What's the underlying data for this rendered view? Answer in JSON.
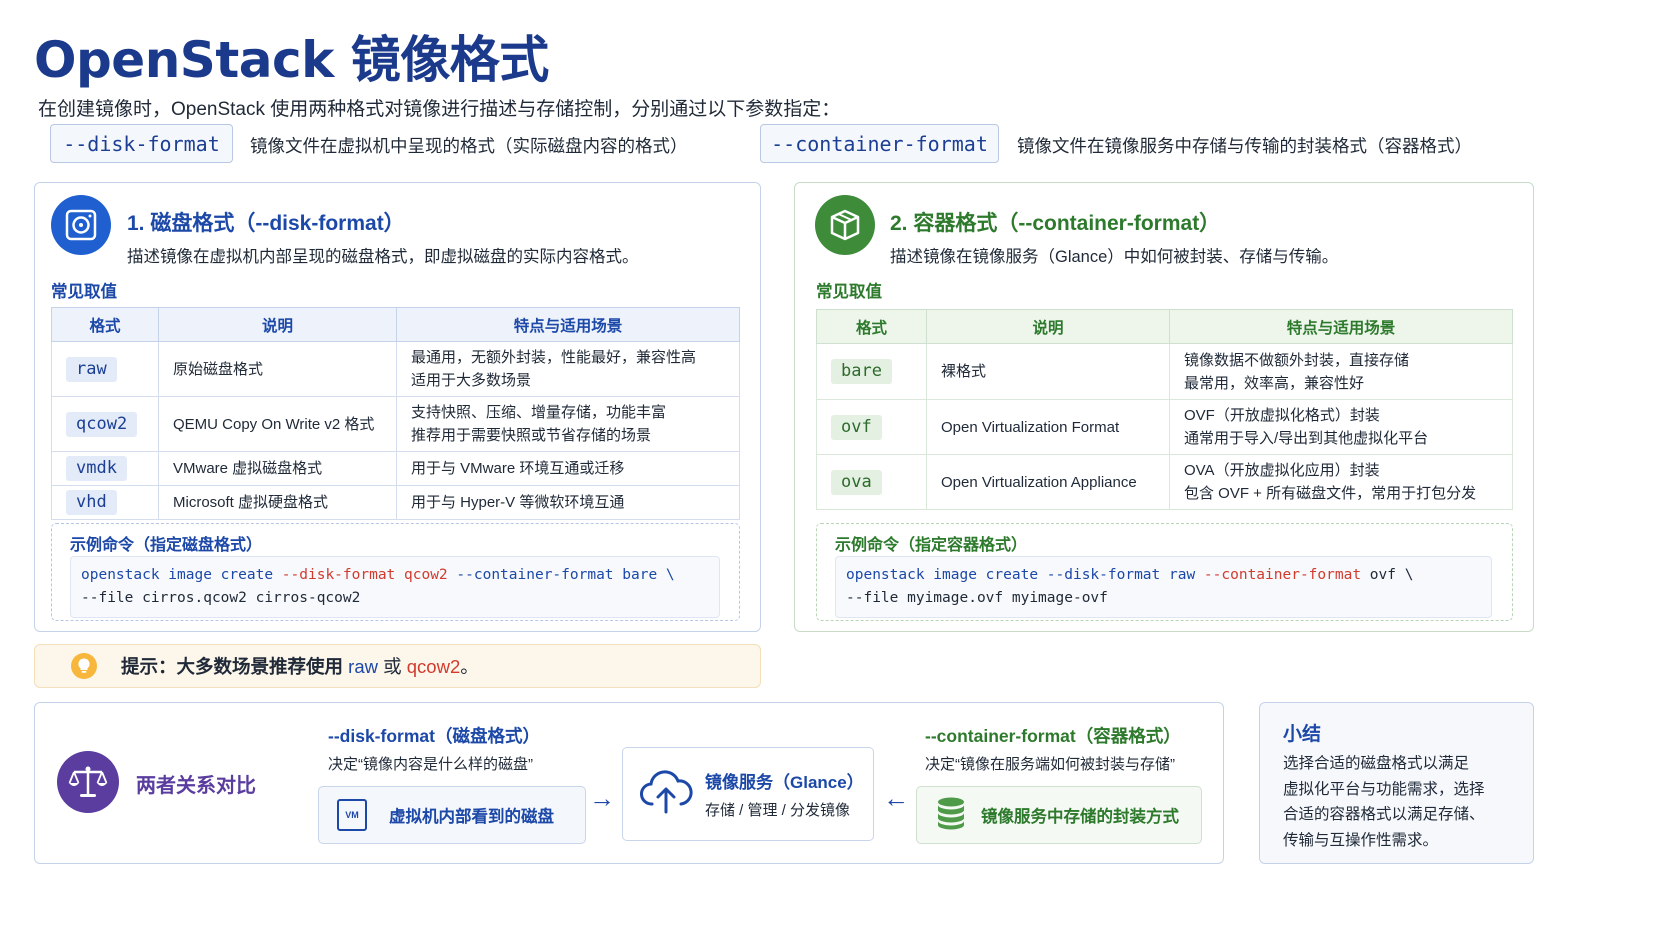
{
  "header": {
    "title": "OpenStack 镜像格式",
    "subtitle": "在创建镜像时，OpenStack 使用两种格式对镜像进行描述与存储控制，分别通过以下参数指定：",
    "params": [
      {
        "name": "--disk-format",
        "desc": "镜像文件在虚拟机中呈现的格式（实际磁盘内容的格式）"
      },
      {
        "name": "--container-format",
        "desc": "镜像文件在镜像服务中存储与传输的封装格式（容器格式）"
      }
    ]
  },
  "disk": {
    "title": "1. 磁盘格式（--disk-format）",
    "desc": "描述镜像在虚拟机内部呈现的磁盘格式，即虚拟磁盘的实际内容格式。",
    "common_label": "常见取值",
    "headers": [
      "格式",
      "说明",
      "特点与适用场景"
    ],
    "rows": [
      {
        "fmt": "raw",
        "desc": "原始磁盘格式",
        "feat1": "最通用，无额外封装，性能最好，兼容性高",
        "feat2": "适用于大多数场景"
      },
      {
        "fmt": "qcow2",
        "desc": "QEMU Copy On Write v2 格式",
        "feat1": "支持快照、压缩、增量存储，功能丰富",
        "feat2": "推荐用于需要快照或节省存储的场景"
      },
      {
        "fmt": "vmdk",
        "desc": "VMware 虚拟磁盘格式",
        "feat1": "用于与 VMware 环境互通或迁移",
        "feat2": ""
      },
      {
        "fmt": "vhd",
        "desc": "Microsoft 虚拟硬盘格式",
        "feat1": "用于与 Hyper-V 等微软环境互通",
        "feat2": ""
      }
    ],
    "example_label": "示例命令（指定磁盘格式）",
    "code": {
      "l1a": "openstack image create ",
      "l1b": "--disk-format qcow2",
      "l1c": " --container-format bare \\",
      "l2": "--file cirros.qcow2 cirros-qcow2"
    }
  },
  "container": {
    "title": "2. 容器格式（--container-format）",
    "desc": "描述镜像在镜像服务（Glance）中如何被封装、存储与传输。",
    "common_label": "常见取值",
    "headers": [
      "格式",
      "说明",
      "特点与适用场景"
    ],
    "rows": [
      {
        "fmt": "bare",
        "desc": "裸格式",
        "feat1": "镜像数据不做额外封装，直接存储",
        "feat2": "最常用，效率高，兼容性好"
      },
      {
        "fmt": "ovf",
        "desc": "Open Virtualization Format",
        "feat1": "OVF（开放虚拟化格式）封装",
        "feat2": "通常用于导入/导出到其他虚拟化平台"
      },
      {
        "fmt": "ova",
        "desc": "Open Virtualization Appliance",
        "feat1": "OVA（开放虚拟化应用）封装",
        "feat2": "包含 OVF + 所有磁盘文件，常用于打包分发"
      }
    ],
    "example_label": "示例命令（指定容器格式）",
    "code": {
      "l1a": "openstack image create --disk-format raw ",
      "l1b": "--container-format",
      "l1c": " ovf \\",
      "l2": "--file myimage.ovf myimage-ovf"
    }
  },
  "tip": {
    "prefix": "提示：大多数场景推荐使用 ",
    "raw": "raw",
    "or": " 或 ",
    "qcow2": "qcow2",
    "end": "。"
  },
  "relation": {
    "title": "两者关系对比",
    "disk_head": "--disk-format（磁盘格式）",
    "disk_sub": "决定“镜像内容是什么样的磁盘”",
    "disk_box": "虚拟机内部看到的磁盘",
    "vm_badge": "VM",
    "glance_title": "镜像服务（Glance）",
    "glance_sub": "存储 / 管理 / 分发镜像",
    "container_head": "--container-format（容器格式）",
    "container_sub": "决定“镜像在服务端如何被封装与存储”",
    "container_box": "镜像服务中存储的封装方式"
  },
  "summary": {
    "title": "小结",
    "lines": [
      "选择合适的磁盘格式以满足",
      "虚拟化平台与功能需求，选择",
      "合适的容器格式以满足存储、",
      "传输与互操作性需求。"
    ]
  },
  "colors": {
    "blue": "#1c48a8",
    "green": "#2d7a2d",
    "red": "#d13b2e",
    "purple": "#5a3d9e"
  }
}
